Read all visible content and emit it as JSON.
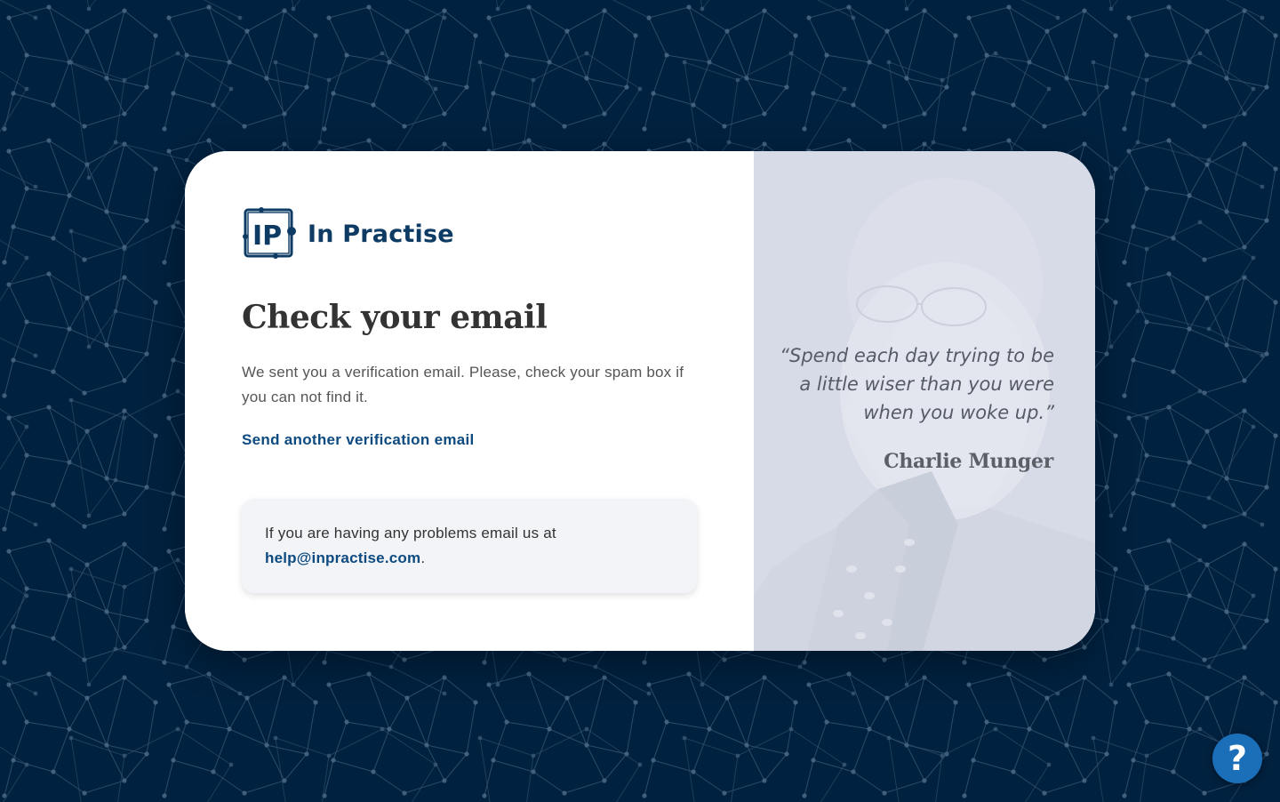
{
  "brand": {
    "name": "In Practise",
    "logo_mark": "IP",
    "color": "#0d3b63"
  },
  "main": {
    "title": "Check your email",
    "description": "We sent you a verification email. Please, check your spam box if you can not find it.",
    "resend_link": "Send another verification email",
    "help": {
      "text": "If you are having any problems email us at",
      "email": "help@inpractise.com",
      "suffix": "."
    }
  },
  "quote_panel": {
    "quote": "“Spend each day trying to be a little wiser than you were when you woke up.”",
    "author": "Charlie Munger"
  },
  "help_button": {
    "icon": "question-icon",
    "glyph": "?"
  },
  "colors": {
    "background": "#00213f",
    "accent": "#0d4a80",
    "help_button": "#1a6fb8"
  }
}
